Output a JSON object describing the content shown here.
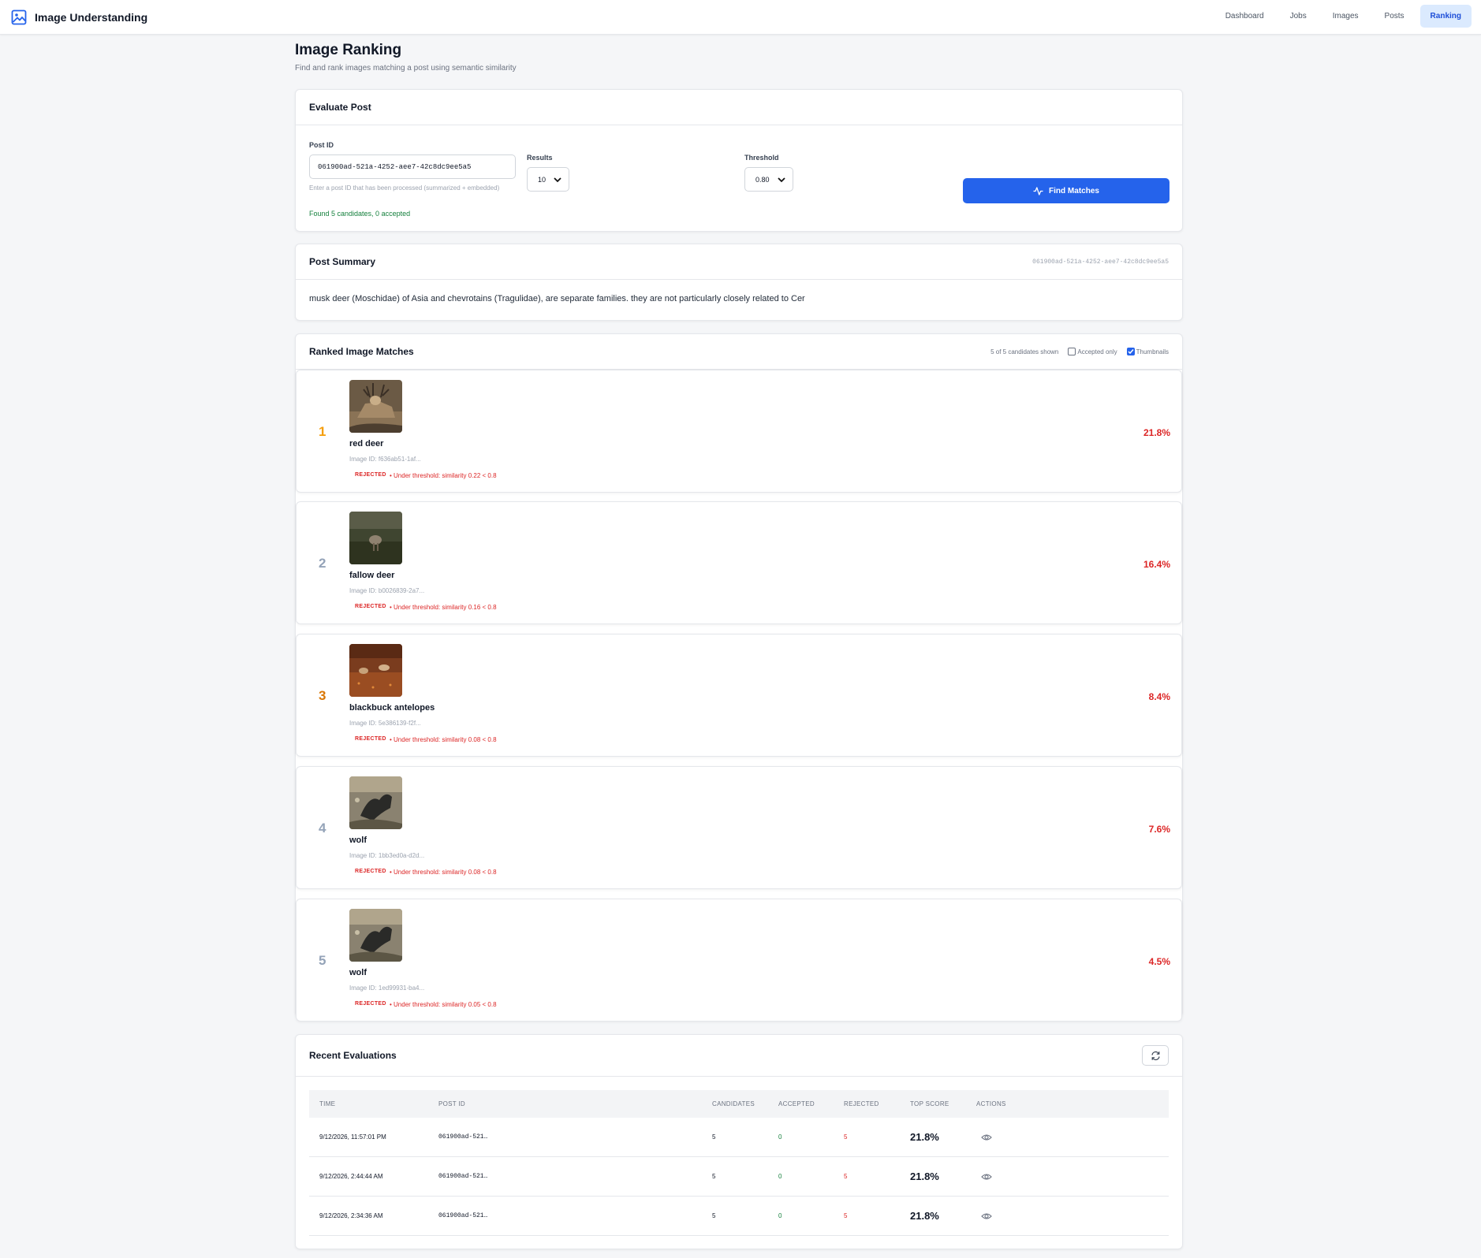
{
  "app": {
    "title": "Image Understanding"
  },
  "nav": [
    {
      "label": "Dashboard",
      "active": false
    },
    {
      "label": "Jobs",
      "active": false
    },
    {
      "label": "Images",
      "active": false
    },
    {
      "label": "Posts",
      "active": false
    },
    {
      "label": "Ranking",
      "active": true
    }
  ],
  "page": {
    "title": "Image Ranking",
    "subtitle": "Find and rank images matching a post using semantic similarity"
  },
  "evaluate": {
    "title": "Evaluate Post",
    "post_id_label": "Post ID",
    "post_id_value": "061900ad-521a-4252-aee7-42c8dc9ee5a5",
    "hint": "Enter a post ID that has been processed (summarized + embedded)",
    "results_label": "Results",
    "results_value": "10",
    "threshold_label": "Threshold",
    "threshold_value": "0.80",
    "button_label": "Find Matches",
    "status": "Found 5 candidates, 0 accepted"
  },
  "summary": {
    "title": "Post Summary",
    "post_id": "061900ad-521a-4252-aee7-42c8dc9ee5a5",
    "text": "musk deer (Moschidae) of Asia and chevrotains (Tragulidae), are separate families. they are not particularly closely related to Cer"
  },
  "ranked": {
    "title": "Ranked Image Matches",
    "shown": "5 of 5 candidates shown",
    "accepted_only_label": "Accepted only",
    "accepted_only_checked": false,
    "thumbnails_label": "Thumbnails",
    "thumbnails_checked": true,
    "items": [
      {
        "rank": "1",
        "label": "red deer",
        "image_id": "Image ID: f636ab51-1af...",
        "status": "REJECTED",
        "reason": "• Under threshold: similarity 0.22 < 0.8",
        "score": "21.8%",
        "rank_color": "#f59e0b"
      },
      {
        "rank": "2",
        "label": "fallow deer",
        "image_id": "Image ID: b0026839-2a7...",
        "status": "REJECTED",
        "reason": "• Under threshold: similarity 0.16 < 0.8",
        "score": "16.4%",
        "rank_color": "#94a3b8"
      },
      {
        "rank": "3",
        "label": "blackbuck antelopes",
        "image_id": "Image ID: 5e386139-f2f...",
        "status": "REJECTED",
        "reason": "• Under threshold: similarity 0.08 < 0.8",
        "score": "8.4%",
        "rank_color": "#d97706"
      },
      {
        "rank": "4",
        "label": "wolf",
        "image_id": "Image ID: 1bb3ed0a-d2d...",
        "status": "REJECTED",
        "reason": "• Under threshold: similarity 0.08 < 0.8",
        "score": "7.6%",
        "rank_color": "#94a3b8"
      },
      {
        "rank": "5",
        "label": "wolf",
        "image_id": "Image ID: 1ed99931-ba4...",
        "status": "REJECTED",
        "reason": "• Under threshold: similarity 0.05 < 0.8",
        "score": "4.5%",
        "rank_color": "#94a3b8"
      }
    ]
  },
  "recent": {
    "title": "Recent Evaluations",
    "columns": [
      "TIME",
      "POST ID",
      "CANDIDATES",
      "ACCEPTED",
      "REJECTED",
      "TOP SCORE",
      "ACTIONS"
    ],
    "rows": [
      {
        "time": "9/12/2026, 11:57:01 PM",
        "post_id": "061900ad-521…",
        "candidates": "5",
        "accepted": "0",
        "rejected": "5",
        "top_score": "21.8%"
      },
      {
        "time": "9/12/2026, 2:44:44 AM",
        "post_id": "061900ad-521…",
        "candidates": "5",
        "accepted": "0",
        "rejected": "5",
        "top_score": "21.8%"
      },
      {
        "time": "9/12/2026, 2:34:36 AM",
        "post_id": "061900ad-521…",
        "candidates": "5",
        "accepted": "0",
        "rejected": "5",
        "top_score": "21.8%"
      }
    ]
  },
  "colors": {
    "accent": "#2563eb",
    "reject": "#dc2626",
    "ok": "#15803d"
  }
}
